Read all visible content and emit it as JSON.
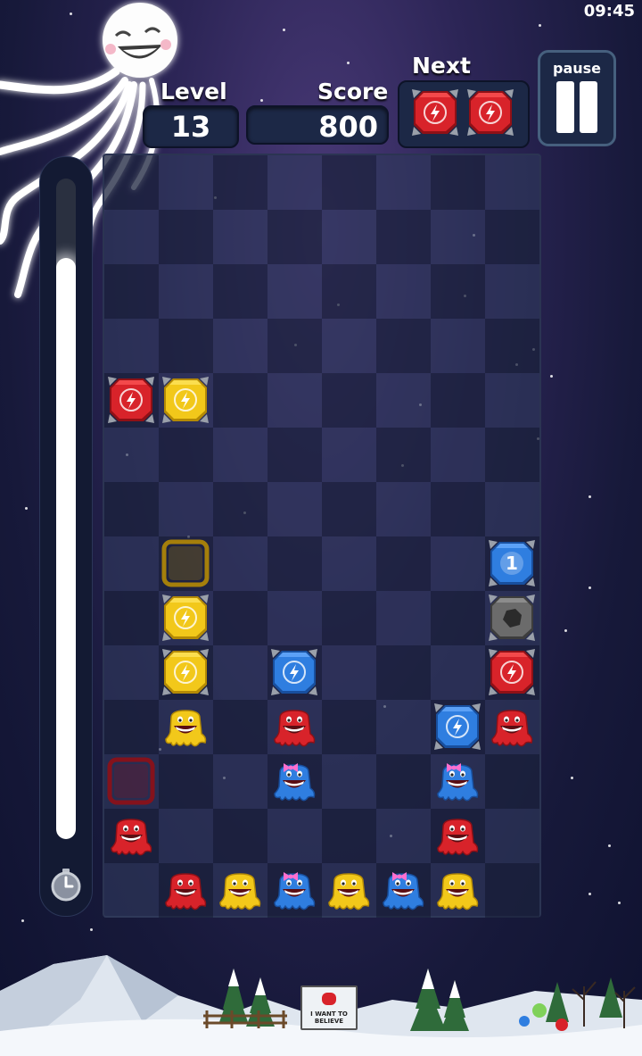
{
  "status_bar": {
    "time": "09:45"
  },
  "hud": {
    "level_label": "Level",
    "level_value": "13",
    "score_label": "Score",
    "score_value": "800",
    "next_label": "Next",
    "pause_label": "pause",
    "next_pieces": [
      "red-lightning-gem",
      "red-lightning-gem"
    ]
  },
  "timer": {
    "fill_fraction": 0.88
  },
  "board": {
    "columns": 8,
    "rows": 14,
    "pieces": [
      {
        "row": 4,
        "col": 0,
        "type": "gem",
        "color": "red",
        "icon": "lightning"
      },
      {
        "row": 4,
        "col": 1,
        "type": "gem",
        "color": "yellow",
        "icon": "lightning"
      },
      {
        "row": 7,
        "col": 1,
        "type": "ghost",
        "color": "yellow"
      },
      {
        "row": 7,
        "col": 7,
        "type": "gem",
        "color": "blue",
        "icon": "number",
        "label": "1"
      },
      {
        "row": 8,
        "col": 1,
        "type": "gem",
        "color": "yellow",
        "icon": "lightning"
      },
      {
        "row": 8,
        "col": 7,
        "type": "gem",
        "color": "gray",
        "icon": "rock"
      },
      {
        "row": 9,
        "col": 1,
        "type": "gem",
        "color": "yellow",
        "icon": "lightning"
      },
      {
        "row": 9,
        "col": 3,
        "type": "gem",
        "color": "blue",
        "icon": "lightning"
      },
      {
        "row": 9,
        "col": 7,
        "type": "gem",
        "color": "red",
        "icon": "lightning"
      },
      {
        "row": 10,
        "col": 1,
        "type": "blob",
        "color": "yellow"
      },
      {
        "row": 10,
        "col": 3,
        "type": "blob",
        "color": "red"
      },
      {
        "row": 10,
        "col": 6,
        "type": "gem",
        "color": "blue",
        "icon": "lightning"
      },
      {
        "row": 10,
        "col": 7,
        "type": "blob",
        "color": "red"
      },
      {
        "row": 11,
        "col": 0,
        "type": "ghost",
        "color": "red"
      },
      {
        "row": 11,
        "col": 3,
        "type": "blob",
        "color": "blue",
        "bow": true
      },
      {
        "row": 11,
        "col": 6,
        "type": "blob",
        "color": "blue",
        "bow": true
      },
      {
        "row": 12,
        "col": 0,
        "type": "blob",
        "color": "red"
      },
      {
        "row": 12,
        "col": 6,
        "type": "blob",
        "color": "red"
      },
      {
        "row": 13,
        "col": 1,
        "type": "blob",
        "color": "red"
      },
      {
        "row": 13,
        "col": 2,
        "type": "blob",
        "color": "yellow"
      },
      {
        "row": 13,
        "col": 3,
        "type": "blob",
        "color": "blue",
        "bow": true
      },
      {
        "row": 13,
        "col": 4,
        "type": "blob",
        "color": "yellow"
      },
      {
        "row": 13,
        "col": 5,
        "type": "blob",
        "color": "blue",
        "bow": true
      },
      {
        "row": 13,
        "col": 6,
        "type": "blob",
        "color": "yellow"
      }
    ]
  },
  "scenery": {
    "sign_text": "I WANT TO BELIEVE"
  },
  "colors": {
    "red": "#d8232a",
    "yellow": "#f2c81a",
    "blue": "#2f7ee0",
    "gray": "#6b6b6b"
  }
}
